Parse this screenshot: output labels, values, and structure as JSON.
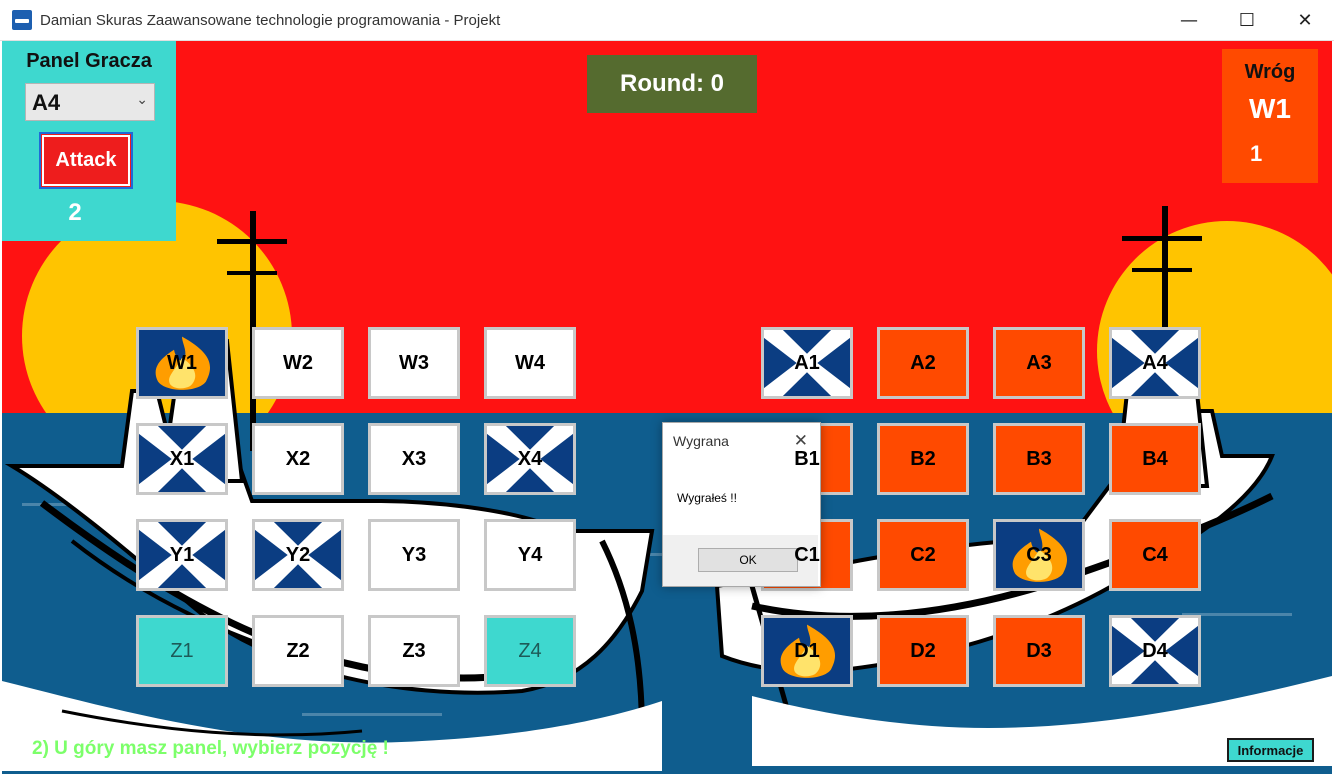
{
  "window": {
    "title": "Damian Skuras Zaawansowane technologie programowania - Projekt",
    "minimize_glyph": "—",
    "maximize_glyph": "☐",
    "close_glyph": "✕",
    "icon": "ship-app-icon"
  },
  "player_panel": {
    "title": "Panel Gracza",
    "selected_position": "A4",
    "select_arrow": "⌄",
    "attack_label": "Attack",
    "count": "2"
  },
  "round": {
    "label": "Round: 0"
  },
  "enemy_panel": {
    "title": "Wróg",
    "target": "W1",
    "count": "1"
  },
  "player_grid": [
    {
      "label": "W1",
      "state": "hit"
    },
    {
      "label": "W2",
      "state": "empty"
    },
    {
      "label": "W3",
      "state": "empty"
    },
    {
      "label": "W4",
      "state": "empty"
    },
    {
      "label": "X1",
      "state": "miss"
    },
    {
      "label": "X2",
      "state": "empty"
    },
    {
      "label": "X3",
      "state": "empty"
    },
    {
      "label": "X4",
      "state": "miss"
    },
    {
      "label": "Y1",
      "state": "miss"
    },
    {
      "label": "Y2",
      "state": "miss"
    },
    {
      "label": "Y3",
      "state": "empty"
    },
    {
      "label": "Y4",
      "state": "empty"
    },
    {
      "label": "Z1",
      "state": "ship"
    },
    {
      "label": "Z2",
      "state": "empty"
    },
    {
      "label": "Z3",
      "state": "empty"
    },
    {
      "label": "Z4",
      "state": "ship"
    }
  ],
  "enemy_grid": [
    {
      "label": "A1",
      "state": "miss"
    },
    {
      "label": "A2",
      "state": "unknown"
    },
    {
      "label": "A3",
      "state": "unknown"
    },
    {
      "label": "A4",
      "state": "miss"
    },
    {
      "label": "B1",
      "state": "unknown"
    },
    {
      "label": "B2",
      "state": "unknown"
    },
    {
      "label": "B3",
      "state": "unknown"
    },
    {
      "label": "B4",
      "state": "unknown"
    },
    {
      "label": "C1",
      "state": "unknown"
    },
    {
      "label": "C2",
      "state": "unknown"
    },
    {
      "label": "C3",
      "state": "hit"
    },
    {
      "label": "C4",
      "state": "unknown"
    },
    {
      "label": "D1",
      "state": "hit"
    },
    {
      "label": "D2",
      "state": "unknown"
    },
    {
      "label": "D3",
      "state": "unknown"
    },
    {
      "label": "D4",
      "state": "miss"
    }
  ],
  "hint": "2) U góry masz panel, wybierz pozycję !",
  "info_button": "Informacje",
  "dialog": {
    "title": "Wygrana",
    "close_glyph": "✕",
    "message": "Wygrałeś !!",
    "ok_label": "OK"
  },
  "colors": {
    "background": "#ff1212",
    "sea": "#0f5d8e",
    "sun": "#ffc400",
    "panel_teal": "#3ed8cf",
    "enemy_orange": "#ff4a00",
    "round_bg": "#556b2f",
    "hint_green": "#7cff6a",
    "tile_blue": "#0b3d82"
  }
}
